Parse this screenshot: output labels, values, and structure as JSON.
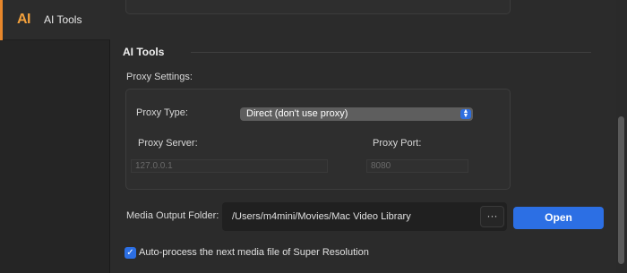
{
  "sidebar": {
    "logo_text": "AI",
    "items": [
      {
        "label": "AI Tools",
        "selected": true,
        "accent": "#e8872b"
      }
    ]
  },
  "section": {
    "title": "AI Tools"
  },
  "proxy": {
    "heading": "Proxy Settings:",
    "type_label": "Proxy Type:",
    "type_value": "Direct (don't use proxy)",
    "server_label": "Proxy Server:",
    "server_placeholder": "127.0.0.1",
    "port_label": "Proxy Port:",
    "port_placeholder": "8080"
  },
  "output": {
    "label": "Media Output Folder:",
    "path": "/Users/m4mini/Movies/Mac Video Library",
    "browse_label": "···",
    "open_label": "Open"
  },
  "auto_process": {
    "checked": true,
    "label": "Auto-process the next media file of Super Resolution"
  },
  "colors": {
    "accent_orange": "#e8872b",
    "primary_blue": "#2c6fe4",
    "background": "#2b2b2b"
  },
  "icons": {
    "logo": "ai-logo-icon",
    "select_arrows": "chevron-updown-icon",
    "checkbox": "checkmark-icon"
  }
}
